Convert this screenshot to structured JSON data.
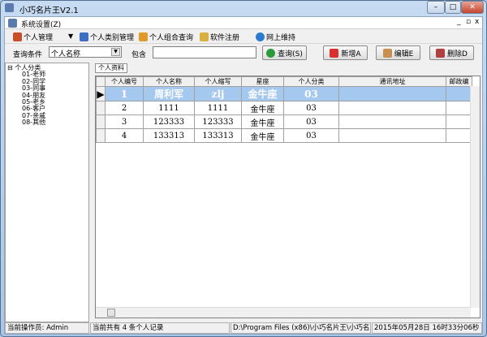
{
  "window": {
    "title": "小巧名片王V2.1",
    "minimize": "–",
    "maximize": "□",
    "close": "✕"
  },
  "menubar": {
    "item": "系统设置(Z)",
    "min": "_",
    "restore": "▫",
    "close": "x"
  },
  "toolbar": [
    {
      "label": "个人管理",
      "icon": "people-icon",
      "color": "#c8502a"
    },
    {
      "label": "个人类别管理",
      "icon": "grid-icon",
      "color": "#3a6fc4"
    },
    {
      "label": "个人组合查询",
      "icon": "combo-icon",
      "color": "#e09a2a"
    },
    {
      "label": "软件注册",
      "icon": "key-icon",
      "color": "#d8b040"
    },
    {
      "label": "网上维持",
      "icon": "globe-icon",
      "color": "#2a7ad0"
    }
  ],
  "toolbar_dropdown": "▼",
  "query": {
    "condition_label": "查询条件",
    "condition_value": "个人名称",
    "contains_label": "包含",
    "search_value": "",
    "search_btn": "查询(S)",
    "add_btn": "新增A",
    "edit_btn": "编辑E",
    "delete_btn": "删除D"
  },
  "tree": {
    "root": "个人分类",
    "items": [
      "01-老师",
      "02-同学",
      "03-同事",
      "04-朋友",
      "05-老乡",
      "06-客户",
      "07-亲戚",
      "08-其他"
    ]
  },
  "tab": "个人资料",
  "grid": {
    "columns": [
      "个人编号",
      "个人名称",
      "个人缩写",
      "星座",
      "个人分类",
      "通讯地址",
      "邮政编"
    ],
    "rows": [
      [
        "1",
        "周利军",
        "zlj",
        "金牛座",
        "03",
        "",
        ""
      ],
      [
        "2",
        "1111",
        "1111",
        "金牛座",
        "03",
        "",
        ""
      ],
      [
        "3",
        "123333",
        "123333",
        "金牛座",
        "03",
        "",
        ""
      ],
      [
        "4",
        "133313",
        "133313",
        "金牛座",
        "03",
        "",
        ""
      ]
    ],
    "selected_row": 0,
    "current_marker": "▶"
  },
  "status": {
    "operator": "当前操作员: Admin",
    "count": "当前共有 4 条个人记录",
    "path": "D:\\Program Files (x86)\\小巧名片王\\小巧名片",
    "datetime": "2015年05月28日 16时33分06秒"
  }
}
